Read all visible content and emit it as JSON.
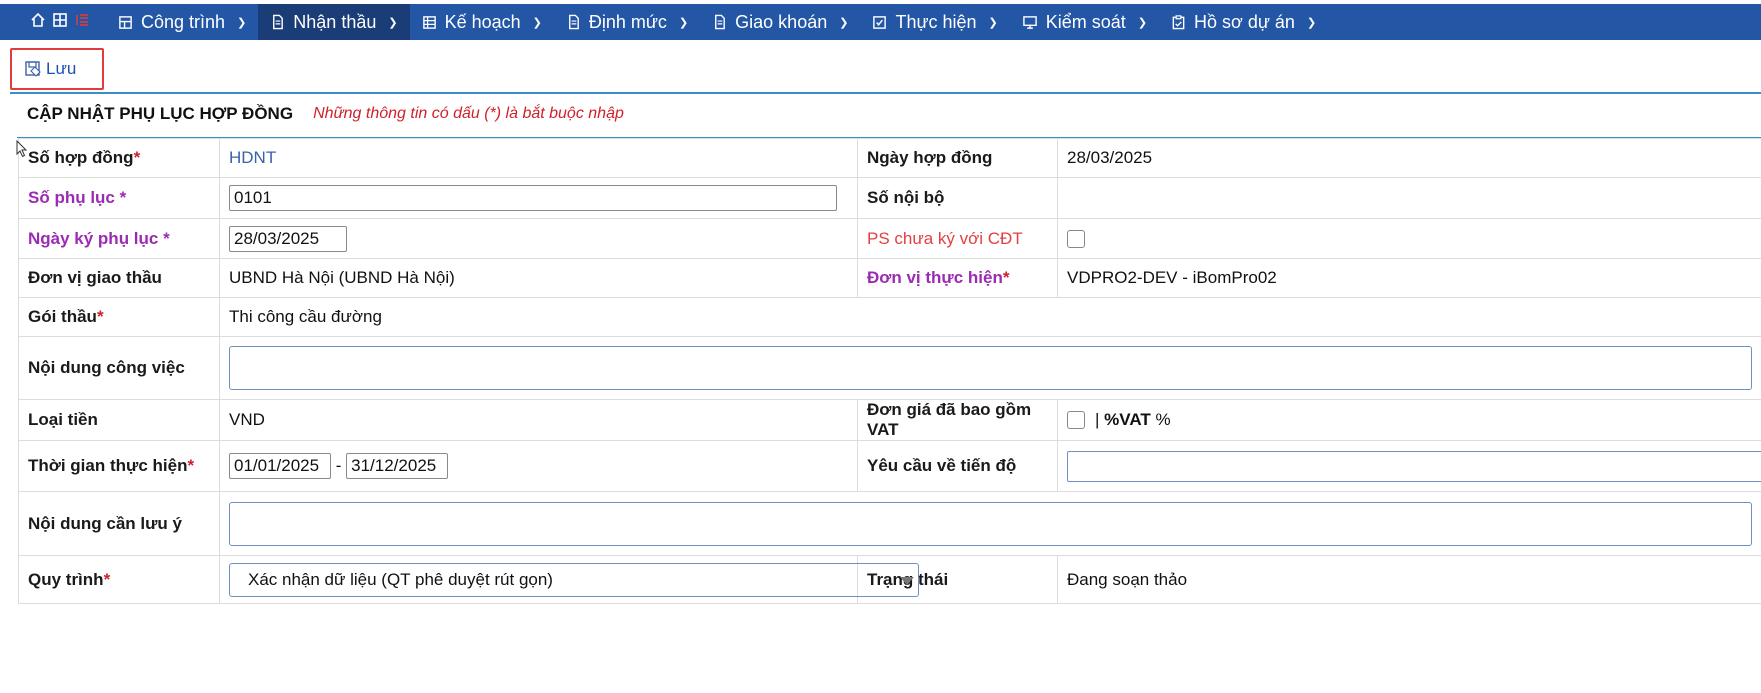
{
  "nav": {
    "items": [
      {
        "label": "Công trình",
        "icon": "grid-icon"
      },
      {
        "label": "Nhận thầu",
        "icon": "document-icon",
        "active": true
      },
      {
        "label": "Kế hoạch",
        "icon": "table-icon"
      },
      {
        "label": "Định mức",
        "icon": "document-icon"
      },
      {
        "label": "Giao khoán",
        "icon": "document-icon"
      },
      {
        "label": "Thực hiện",
        "icon": "check-square-icon"
      },
      {
        "label": "Kiểm soát",
        "icon": "monitor-icon"
      },
      {
        "label": "Hồ sơ dự án",
        "icon": "clipboard-icon"
      }
    ]
  },
  "toolbar": {
    "save_label": "Lưu"
  },
  "form": {
    "title": "CẬP NHẬT PHỤ LỤC HỢP ĐỒNG",
    "note": "Những thông tin có dấu (*) là bắt buộc nhập",
    "contract_no": {
      "label": "Số hợp đồng",
      "value": "HDNT"
    },
    "contract_date": {
      "label": "Ngày hợp đồng",
      "value": "28/03/2025"
    },
    "appendix_no": {
      "label": "Số phụ lục *",
      "value": "0101"
    },
    "internal_no": {
      "label": "Số nội bộ",
      "value": ""
    },
    "appendix_date": {
      "label": "Ngày ký phụ lục *",
      "value": "28/03/2025"
    },
    "ps_unsigned": {
      "label": "PS chưa ký với CĐT"
    },
    "contractor": {
      "label": "Đơn vị giao thầu",
      "value": "UBND Hà Nội (UBND Hà Nội)"
    },
    "executor": {
      "label": "Đơn vị thực hiện",
      "value": "VDPRO2-DEV - iBomPro02"
    },
    "package": {
      "label": "Gói thầu",
      "value": "Thi công cầu đường"
    },
    "work_content": {
      "label": "Nội dung công việc",
      "value": ""
    },
    "currency": {
      "label": "Loại tiền",
      "value": "VND"
    },
    "vat_included": {
      "label": "Đơn giá đã bao gồm VAT",
      "separator": "|",
      "vat_label": "%VAT",
      "vat_unit": "%"
    },
    "period": {
      "label": "Thời gian thực hiện",
      "from": "01/01/2025",
      "dash": "-",
      "to": "31/12/2025"
    },
    "progress_req": {
      "label": "Yêu cầu về tiến độ",
      "value": ""
    },
    "notes": {
      "label": "Nội dung cần lưu ý",
      "value": ""
    },
    "workflow": {
      "label": "Quy trình",
      "value": "Xác nhận dữ liệu (QT phê duyệt rút gọn)"
    },
    "status": {
      "label": "Trạng thái",
      "value": "Đang soạn thảo"
    },
    "required_mark": "*"
  },
  "colors": {
    "nav_bg": "#2456a6",
    "nav_active": "#1a3d78",
    "required": "#d0202a",
    "purple_label": "#9c2bb4",
    "save_border": "#e23b3b"
  }
}
